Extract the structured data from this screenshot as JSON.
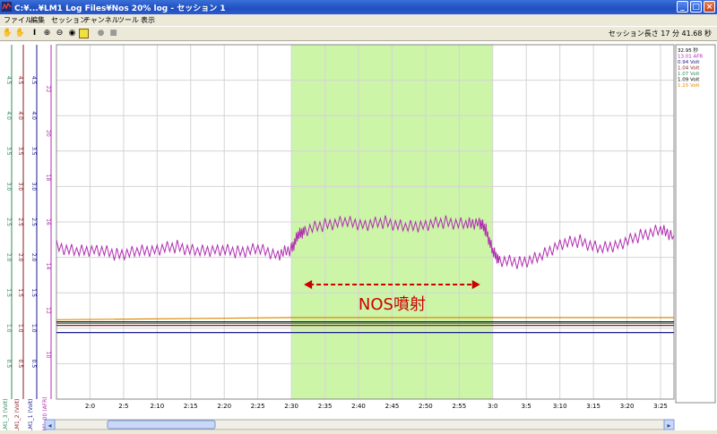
{
  "window": {
    "title": "C:¥...¥LM1 Log Files¥Nos 20% log - セッション 1",
    "minimize_glyph": "_",
    "maximize_glyph": "□",
    "close_glyph": "×"
  },
  "menu": [
    "ファイル",
    "編集",
    "セッション",
    "チャンネル",
    "ツール",
    "表示"
  ],
  "toolbar": {
    "icons": [
      "hand-icon",
      "hand-disabled-icon",
      "text-cursor-icon",
      "zoom-in-icon",
      "zoom-out-icon",
      "zoom-reset-icon",
      "marker-icon",
      "record-icon",
      "stop-icon"
    ],
    "session_length": "セッション長さ 17 分 41.68 秒"
  },
  "left_axes": [
    {
      "name": "LM1_3 (Volt)",
      "color": "#2e8b57",
      "ticks": [
        "0.5",
        "1.0",
        "1.5",
        "2.0",
        "2.5",
        "3.0",
        "3.5",
        "4.0",
        "4.5"
      ]
    },
    {
      "name": "LM1_2 (Volt)",
      "color": "#8b1a1a",
      "ticks": [
        "0.5",
        "1.0",
        "1.5",
        "2.0",
        "2.5",
        "3.0",
        "3.5",
        "4.0",
        "4.5"
      ]
    },
    {
      "name": "LM1_1 (Volt)",
      "color": "#1a1a8b",
      "ticks": [
        "0.5",
        "1.0",
        "1.5",
        "2.0",
        "2.5",
        "3.0",
        "3.5",
        "4.0",
        "4.5"
      ]
    },
    {
      "name": "LM1_00 (AFR)",
      "color": "#b02fb0",
      "ticks": [
        "10",
        "12",
        "14",
        "16",
        "18",
        "20",
        "22"
      ]
    }
  ],
  "legend": [
    {
      "text": "32.95 秒",
      "color": "#000000"
    },
    {
      "text": "13.01 AFR",
      "color": "#b02fb0"
    },
    {
      "text": "0.94 Volt",
      "color": "#1a1a8b"
    },
    {
      "text": "1.04 Volt",
      "color": "#8b1a1a"
    },
    {
      "text": "1.07 Volt",
      "color": "#2e8b57"
    },
    {
      "text": "1.09 Volt",
      "color": "#000000"
    },
    {
      "text": "1.15 Volt",
      "color": "#e08a00"
    }
  ],
  "annotation": {
    "text": "NOS噴射",
    "color": "#cc0000"
  },
  "chart_data": {
    "type": "line",
    "x_ticks": [
      "2:0",
      "2:5",
      "2:10",
      "2:15",
      "2:20",
      "2:25",
      "2:30",
      "2:35",
      "2:40",
      "2:45",
      "2:50",
      "2:55",
      "3:0",
      "3:5",
      "3:10",
      "3:15",
      "3:20",
      "3:25"
    ],
    "xlim_seconds": [
      115,
      207
    ],
    "highlight_seconds": [
      150,
      180
    ],
    "highlight_color": "#ccf5a8",
    "grid": true,
    "series": [
      {
        "name": "LM1_00 (AFR)",
        "color": "#b02fb0",
        "ylim": [
          10,
          23
        ],
        "x": [
          115,
          118,
          121,
          124,
          127,
          130,
          133,
          136,
          139,
          142,
          145,
          148,
          150,
          151,
          152,
          155,
          158,
          161,
          164,
          167,
          170,
          173,
          176,
          178,
          179,
          180,
          181,
          184,
          187,
          190,
          193,
          196,
          199,
          202,
          205,
          207
        ],
        "y": [
          15.6,
          15.4,
          15.5,
          15.3,
          15.4,
          15.5,
          15.6,
          15.4,
          15.5,
          15.4,
          15.5,
          15.3,
          15.5,
          16.0,
          16.2,
          16.4,
          16.5,
          16.4,
          16.5,
          16.3,
          16.4,
          16.5,
          16.4,
          16.5,
          16.2,
          15.4,
          15.1,
          15.0,
          15.2,
          15.7,
          15.8,
          15.5,
          15.7,
          16.0,
          16.2,
          16.0
        ]
      },
      {
        "name": "1.15 Volt",
        "color": "#e08a00",
        "ylim": [
          0,
          5
        ],
        "x": [
          115,
          150,
          207
        ],
        "y": [
          1.12,
          1.15,
          1.15
        ]
      },
      {
        "name": "1.09 Volt",
        "color": "#000000",
        "ylim": [
          0,
          5
        ],
        "x": [
          115,
          150,
          207
        ],
        "y": [
          1.09,
          1.09,
          1.09
        ]
      },
      {
        "name": "1.07 Volt",
        "color": "#2e8b57",
        "ylim": [
          0,
          5
        ],
        "x": [
          115,
          150,
          207
        ],
        "y": [
          1.07,
          1.07,
          1.07
        ]
      },
      {
        "name": "1.04 Volt",
        "color": "#8b1a1a",
        "ylim": [
          0,
          5
        ],
        "x": [
          115,
          150,
          207
        ],
        "y": [
          1.04,
          1.04,
          1.04
        ]
      },
      {
        "name": "0.94 Volt",
        "color": "#1a1a8b",
        "ylim": [
          0,
          5
        ],
        "x": [
          115,
          150,
          207
        ],
        "y": [
          0.94,
          0.94,
          0.94
        ]
      }
    ]
  }
}
